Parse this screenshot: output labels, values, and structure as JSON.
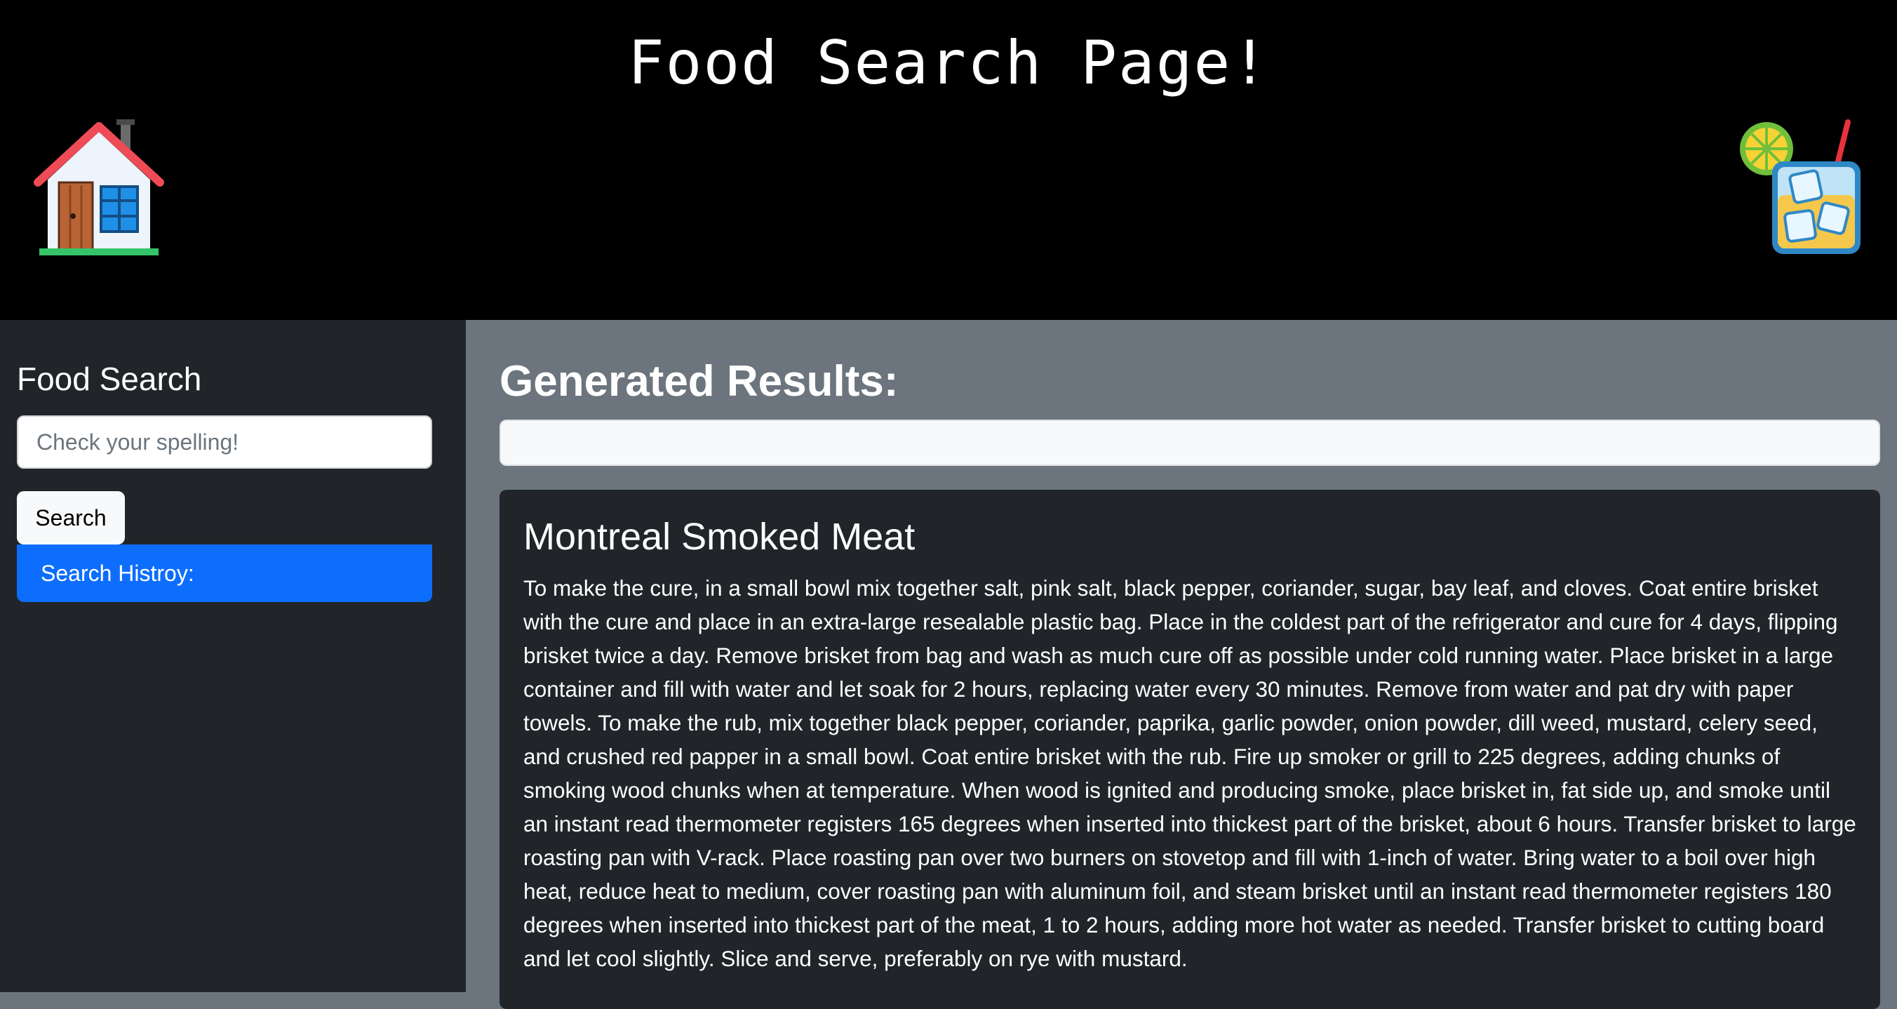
{
  "header": {
    "title": "Food Search Page!",
    "home_icon": "house-icon",
    "drink_icon": "cocktail-drink-icon"
  },
  "sidebar": {
    "title": "Food Search",
    "search_placeholder": "Check your spelling!",
    "search_button_label": "Search",
    "history_label": "Search Histroy:"
  },
  "main": {
    "results_title": "Generated Results:",
    "results": [
      {
        "title": "Montreal Smoked Meat",
        "instructions": "To make the cure, in a small bowl mix together salt, pink salt, black pepper, coriander, sugar, bay leaf, and cloves. Coat entire brisket with the cure and place in an extra-large resealable plastic bag. Place in the coldest part of the refrigerator and cure for 4 days, flipping brisket twice a day. Remove brisket from bag and wash as much cure off as possible under cold running water. Place brisket in a large container and fill with water and let soak for 2 hours, replacing water every 30 minutes. Remove from water and pat dry with paper towels. To make the rub, mix together black pepper, coriander, paprika, garlic powder, onion powder, dill weed, mustard, celery seed, and crushed red papper in a small bowl. Coat entire brisket with the rub. Fire up smoker or grill to 225 degrees, adding chunks of smoking wood chunks when at temperature. When wood is ignited and producing smoke, place brisket in, fat side up, and smoke until an instant read thermometer registers 165 degrees when inserted into thickest part of the brisket, about 6 hours. Transfer brisket to large roasting pan with V-rack. Place roasting pan over two burners on stovetop and fill with 1-inch of water. Bring water to a boil over high heat, reduce heat to medium, cover roasting pan with aluminum foil, and steam brisket until an instant read thermometer registers 180 degrees when inserted into thickest part of the meat, 1 to 2 hours, adding more hot water as needed. Transfer brisket to cutting board and let cool slightly. Slice and serve, preferably on rye with mustard."
      }
    ]
  },
  "colors": {
    "header_bg": "#000000",
    "sidebar_bg": "#212529",
    "main_bg": "#6c757d",
    "accent": "#0d6efd",
    "card_bg": "#212529"
  }
}
